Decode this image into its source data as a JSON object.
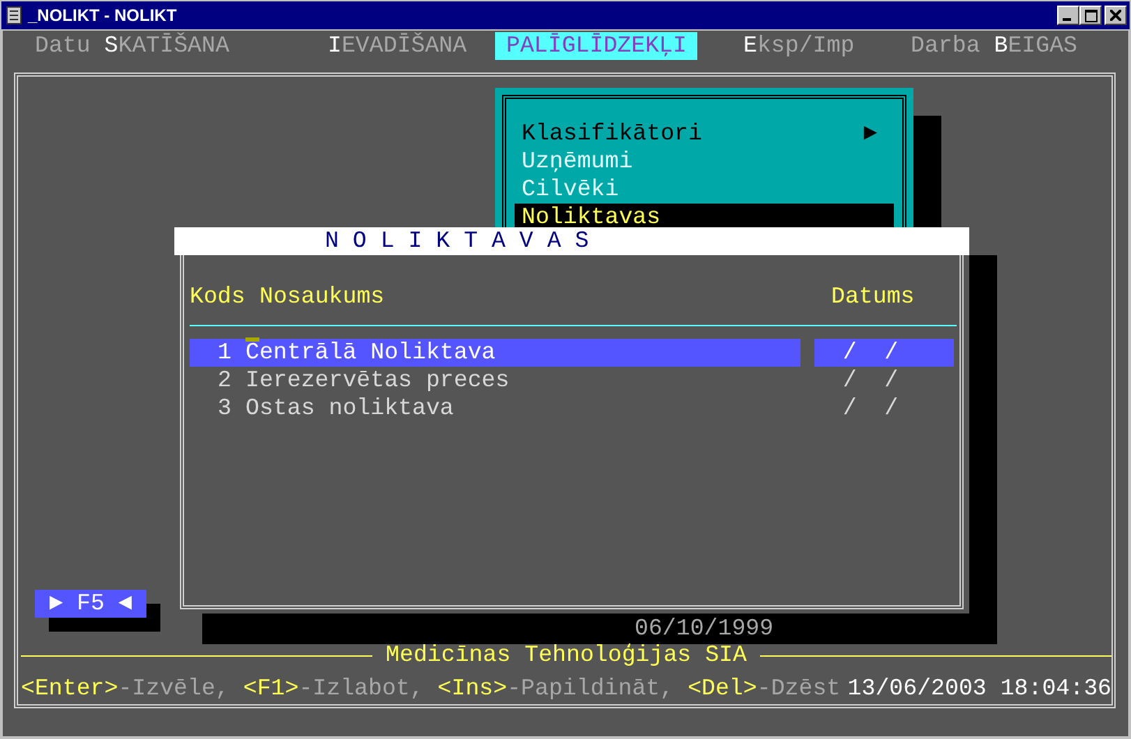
{
  "window": {
    "title": "_NOLIKT - NOLIKT"
  },
  "menu": [
    {
      "label": "Datu **S**KATĪŠANA",
      "selected": false
    },
    {
      "label": "**I**EVADĪŠANA",
      "selected": false
    },
    {
      "label": "PALĪGLĪDZEKĻI",
      "selected": true
    },
    {
      "label": "**E**ksp/Imp",
      "selected": false
    },
    {
      "label": "Darba **B**EIGAS",
      "selected": false
    }
  ],
  "submenu": {
    "items": [
      {
        "label": "Klasifikātori",
        "selected": false,
        "disabled": false,
        "arrow": "►"
      },
      {
        "label": "Uzņēmumi",
        "selected": false,
        "disabled": true
      },
      {
        "label": "Cilvēki",
        "selected": false,
        "disabled": true
      },
      {
        "label": "Noliktavas",
        "selected": true,
        "disabled": false
      }
    ]
  },
  "dialog": {
    "title": "N O L I K T A V A S",
    "columns": [
      "Kods",
      "Nosaukums",
      "Datums"
    ],
    "rows": [
      {
        "code": "1",
        "name": "Centrālā Noliktava",
        "date": "/  /",
        "selected": true
      },
      {
        "code": "2",
        "name": "Ierezervētas preces",
        "date": "/  /",
        "selected": false
      },
      {
        "code": "3",
        "name": "Ostas noliktava",
        "date": "/  /",
        "selected": false
      }
    ]
  },
  "f5_button": "► F5 ◄",
  "shadow_date": "06/10/1999",
  "company": "Medicīnas Tehnoloģijas SIA",
  "hints": [
    {
      "key": "<Enter>",
      "action": "-Izvēle,"
    },
    {
      "key": "<F1>",
      "action": "-Izlabot,"
    },
    {
      "key": "<Ins>",
      "action": "-Papildināt,"
    },
    {
      "key": "<Del>",
      "action": "-Dzēst"
    }
  ],
  "datetime": "13/06/2003 18:04:36"
}
